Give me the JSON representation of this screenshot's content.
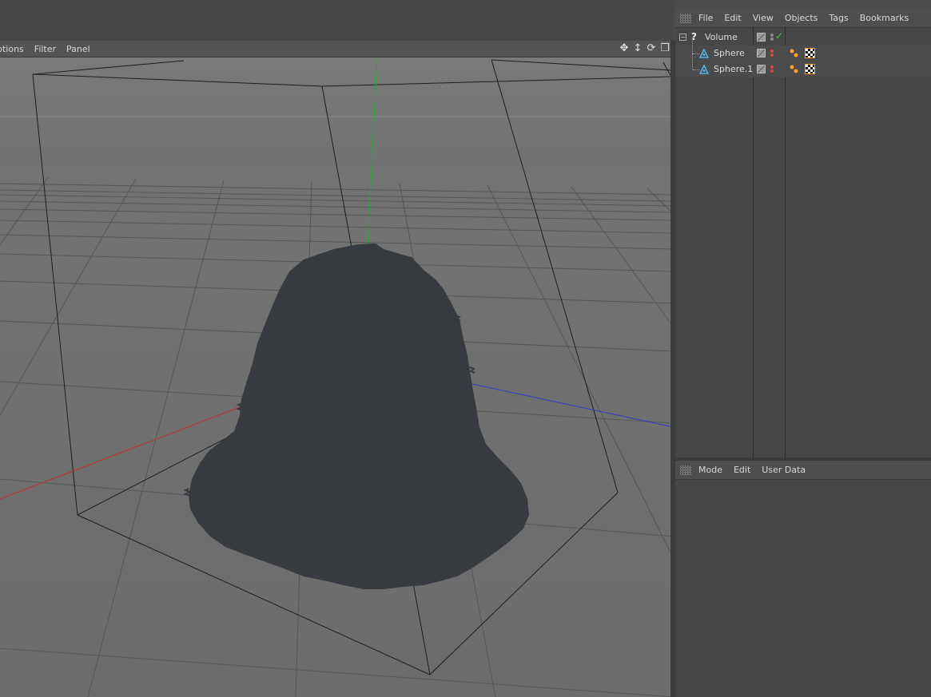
{
  "viewport": {
    "menu": [
      "ptions",
      "Filter",
      "Panel"
    ],
    "nav_icons": [
      "move-view-icon",
      "zoom-view-icon",
      "rotate-view-icon",
      "toggle-layout-icon"
    ]
  },
  "object_manager": {
    "menu": [
      "File",
      "Edit",
      "View",
      "Objects",
      "Tags",
      "Bookmarks"
    ],
    "objects": [
      {
        "name": "Volume",
        "icon": "volume-question-icon",
        "expanded": true,
        "level": 0,
        "enabled": true
      },
      {
        "name": "Sphere",
        "icon": "sphere-icon",
        "level": 1,
        "tags": [
          "material-tag",
          "texture-tag"
        ]
      },
      {
        "name": "Sphere.1",
        "icon": "sphere-icon",
        "level": 1,
        "tags": [
          "material-tag",
          "texture-tag"
        ]
      }
    ]
  },
  "attribute_manager": {
    "menu": [
      "Mode",
      "Edit",
      "User Data"
    ]
  },
  "colors": {
    "x_axis": "#c0302e",
    "y_axis": "#27a838",
    "z_axis": "#2d3ccc",
    "mesh": "#373b40",
    "viewport_bg": "#6a6a6a",
    "checkmark": "#4ec24e",
    "tag_accent": "#ff9c2a",
    "sphere_icon": "#5ab4e8"
  }
}
